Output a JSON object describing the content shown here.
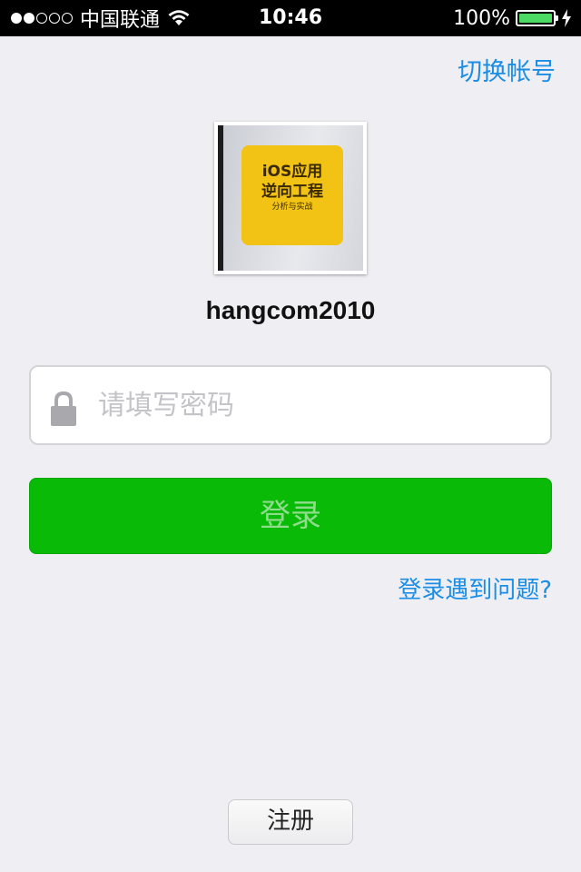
{
  "status_bar": {
    "carrier": "中国联通",
    "time": "10:46",
    "battery_text": "100%",
    "signal_strength": 2,
    "signal_max": 5,
    "battery_level": 1.0,
    "icons": [
      "signal-dots-icon",
      "wifi-icon",
      "battery-icon",
      "charging-bolt-icon"
    ]
  },
  "header": {
    "switch_account": "切换帐号"
  },
  "profile": {
    "username": "hangcom2010",
    "avatar_cover_title_1": "iOS应用",
    "avatar_cover_title_2": "逆向工程",
    "avatar_cover_subtitle": "分析与实战"
  },
  "password": {
    "placeholder": "请填写密码",
    "value": ""
  },
  "actions": {
    "login": "登录",
    "login_problem": "登录遇到问题?",
    "register": "注册"
  },
  "colors": {
    "link": "#1a8ee6",
    "login_button": "#09bb07",
    "login_text": "#8fdc8c",
    "background": "#eeeef3"
  }
}
